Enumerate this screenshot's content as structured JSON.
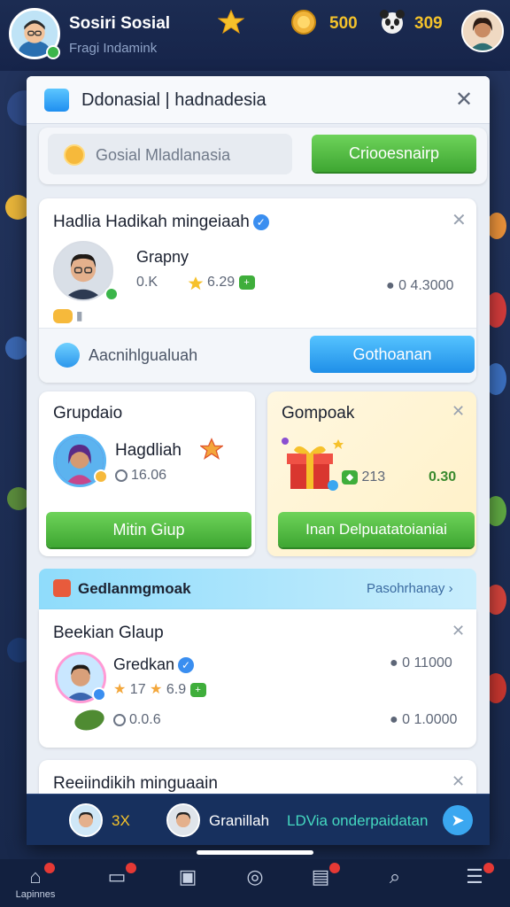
{
  "header": {
    "name": "Sosiri Sosial",
    "subtitle": "Fragi Indamink",
    "coins": "500",
    "panda_points": "309"
  },
  "sheet": {
    "title": "Ddonasial | hadnadesia",
    "search_text": "Gosial Mladlanasia",
    "search_button": "Criooesnairp"
  },
  "post": {
    "title": "Hadlia Hadikah mingeiaah",
    "name": "Grapny",
    "count": "0.K",
    "stars": "6.29",
    "stat": "● 0 4.3000",
    "footer_text": "Aacnihlgualuah",
    "footer_button": "Gothoanan"
  },
  "group_card": {
    "head": "Grupdaio",
    "name": "Hagdliah",
    "time": "16.06",
    "button": "Mitin Giup"
  },
  "gift_card": {
    "head": "Gompoak",
    "value1": "213",
    "value2": "0.30",
    "button": "Inan Delpuatatoianiai"
  },
  "section": {
    "title": "Gedlanmgmoak",
    "link": "Pasohrhanay ›"
  },
  "list_item": {
    "head": "Beekian Glaup",
    "name": "Gredkan",
    "stat1": "● 0 11000",
    "stars": "17",
    "stars_value": "6.9",
    "time": "0.0.6",
    "stat2": "● 0 1.0000"
  },
  "next_item": {
    "head": "Reeiindikih minguaain"
  },
  "ticker": {
    "count": "3X",
    "user": "Granillah",
    "message": "LDVia onderpaidatan"
  },
  "nav": {
    "home_label": "Lapinnes"
  },
  "colors": {
    "accent_green": "#3ea632",
    "accent_blue": "#1f8fe8",
    "gold": "#f4c22b"
  }
}
